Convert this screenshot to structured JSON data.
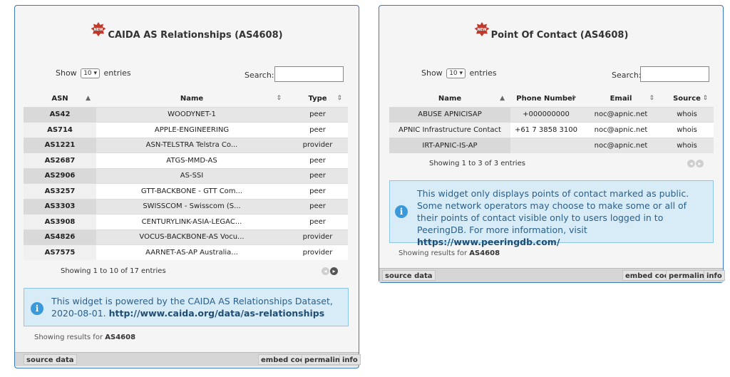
{
  "left": {
    "title": "CAIDA AS Relationships (AS4608)",
    "show_label": "Show",
    "show_value": "10",
    "entries_label": "entries",
    "search_label": "Search:",
    "columns": [
      "ASN",
      "Name",
      "Type"
    ],
    "rows": [
      [
        "AS42",
        "WOODYNET-1",
        "peer"
      ],
      [
        "AS714",
        "APPLE-ENGINEERING",
        "peer"
      ],
      [
        "AS1221",
        "ASN-TELSTRA Telstra Co...",
        "provider"
      ],
      [
        "AS2687",
        "ATGS-MMD-AS",
        "peer"
      ],
      [
        "AS2906",
        "AS-SSI",
        "peer"
      ],
      [
        "AS3257",
        "GTT-BACKBONE - GTT Com...",
        "peer"
      ],
      [
        "AS3303",
        "SWISSCOM - Swisscom (S...",
        "peer"
      ],
      [
        "AS3908",
        "CENTURYLINK-ASIA-LEGAC...",
        "peer"
      ],
      [
        "AS4826",
        "VOCUS-BACKBONE-AS Vocu...",
        "provider"
      ],
      [
        "AS7575",
        "AARNET-AS-AP Australia...",
        "provider"
      ]
    ],
    "showing_entries": "Showing 1 to 10 of 17 entries",
    "info_text": "This widget is powered by the CAIDA AS Relationships Dataset, 2020-08-01.",
    "info_link": "http://www.caida.org/data/as-relationships",
    "results_prefix": "Showing results for",
    "results_asn": "AS4608",
    "footer_source": "source data",
    "footer_embed": "embed code",
    "footer_permalink": "permalink",
    "footer_info": "info"
  },
  "right": {
    "title": "Point Of Contact (AS4608)",
    "show_label": "Show",
    "show_value": "10",
    "entries_label": "entries",
    "search_label": "Search:",
    "columns": [
      "Name",
      "Phone Number",
      "Email",
      "Source"
    ],
    "rows": [
      [
        "ABUSE APNICISAP",
        "+000000000",
        "noc@apnic.net",
        "whois"
      ],
      [
        "APNIC Infrastructure Contact",
        "+61 7 3858 3100",
        "noc@apnic.net",
        "whois"
      ],
      [
        "IRT-APNIC-IS-AP",
        "",
        "noc@apnic.net",
        "whois"
      ]
    ],
    "showing_entries": "Showing 1 to 3 of 3 entries",
    "info_text": "This widget only displays points of contact marked as public. Some network operators may choose to make some or all of their points of contact visible only to users logged in to PeeringDB. For more information, visit",
    "info_link": "https://www.peeringdb.com/",
    "results_prefix": "Showing results for",
    "results_asn": "AS4608",
    "footer_source": "source data",
    "footer_embed": "embed code",
    "footer_permalink": "permalink",
    "footer_info": "info"
  },
  "icons": {
    "new_badge": "new-badge-icon",
    "info": "info-icon",
    "prev": "prev-page-icon",
    "next": "next-page-icon"
  },
  "colors": {
    "border": "#3a7ab8",
    "info_bg": "#d8ecf7",
    "info_text": "#2a5f8a",
    "badge": "#c0392b"
  }
}
